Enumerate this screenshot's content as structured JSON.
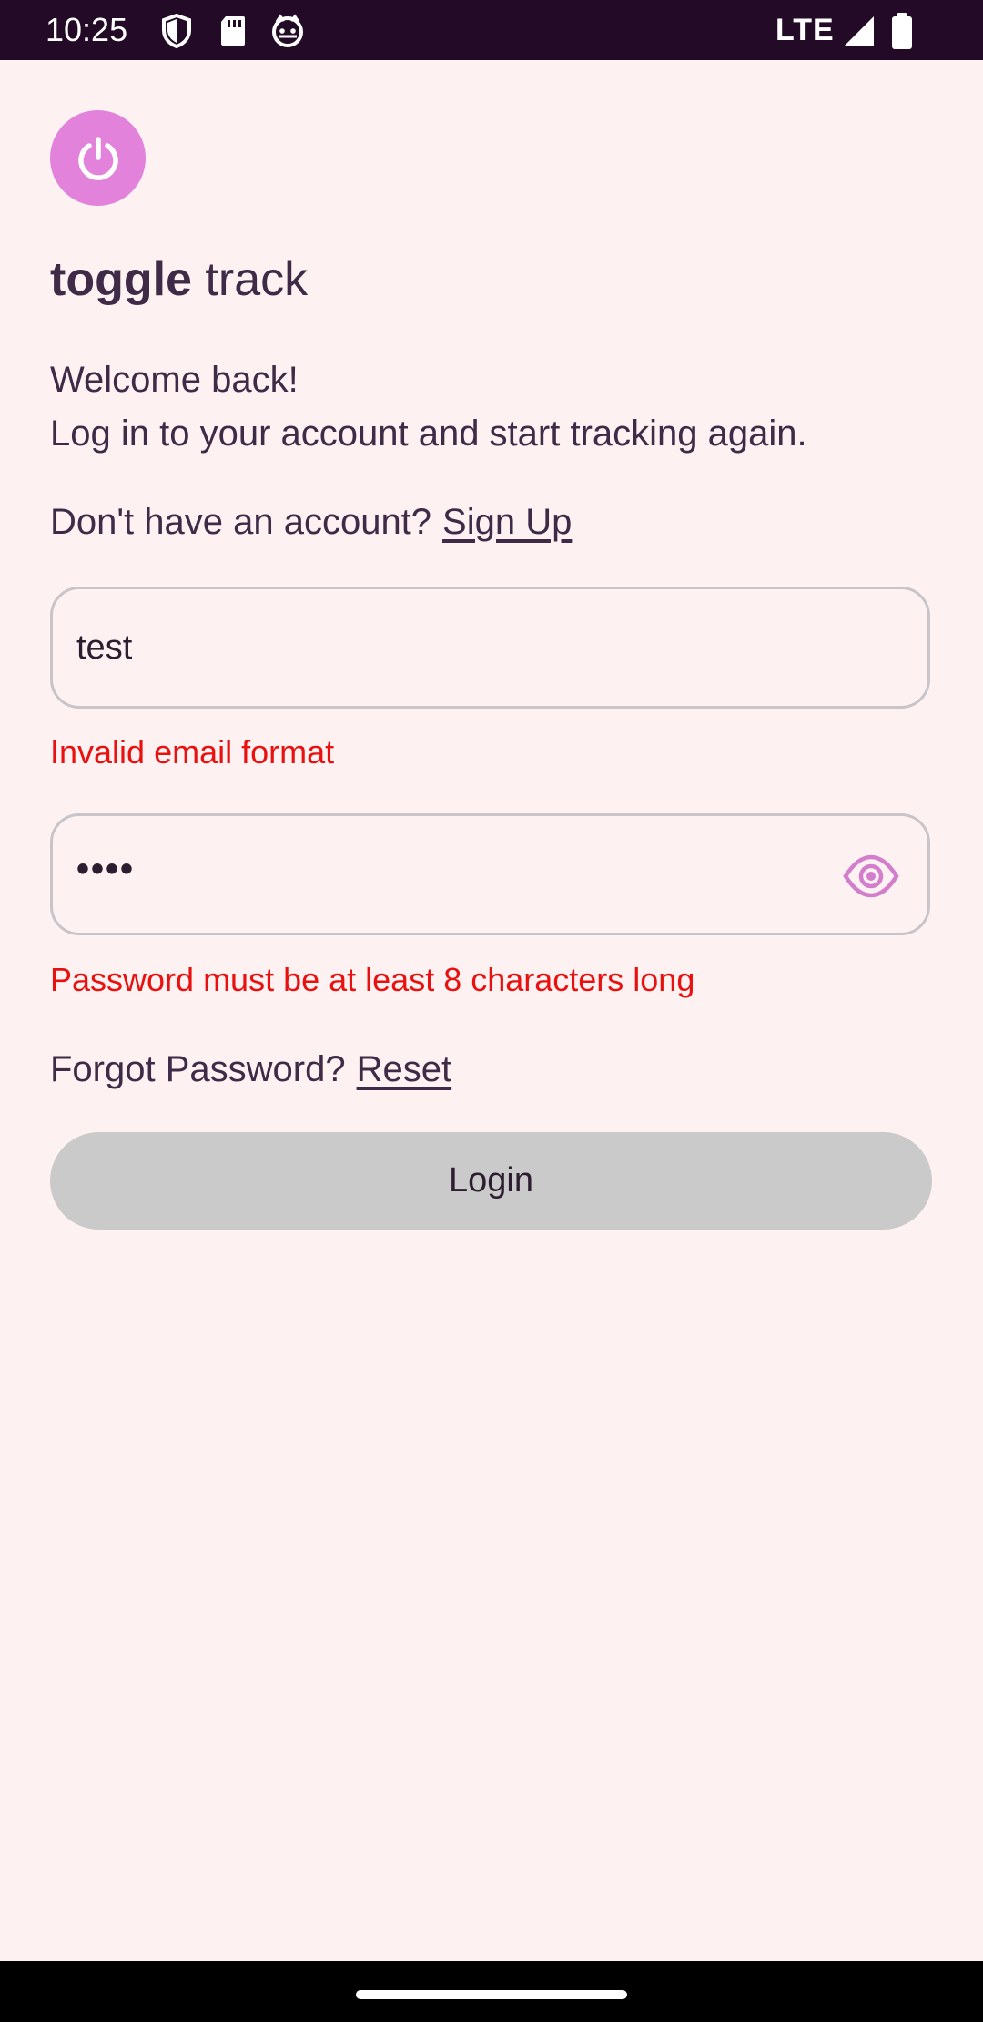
{
  "status_bar": {
    "time": "10:25",
    "network": "LTE",
    "icons": [
      "shield-icon",
      "sd-card-icon",
      "cat-icon",
      "signal-icon",
      "battery-icon"
    ]
  },
  "app": {
    "logo_icon": "power-icon",
    "brand_bold": "toggle",
    "brand_rest": " track",
    "welcome_line1": "Welcome back!",
    "welcome_line2": "Log in to your account and start tracking again.",
    "signup_prompt": "Don't have an account?",
    "signup_link": "Sign Up",
    "email_value": "test",
    "email_error": "Invalid email format",
    "password_value": "••••",
    "password_error": "Password must be at least 8 characters long",
    "forgot_prompt": "Forgot Password?",
    "reset_link": "Reset",
    "login_label": "Login"
  },
  "colors": {
    "background": "#fdf2f1",
    "status_bar": "#230a27",
    "accent": "#e282da",
    "error": "#e8110f",
    "button_disabled": "#cacaca",
    "text": "#3f2a47"
  }
}
